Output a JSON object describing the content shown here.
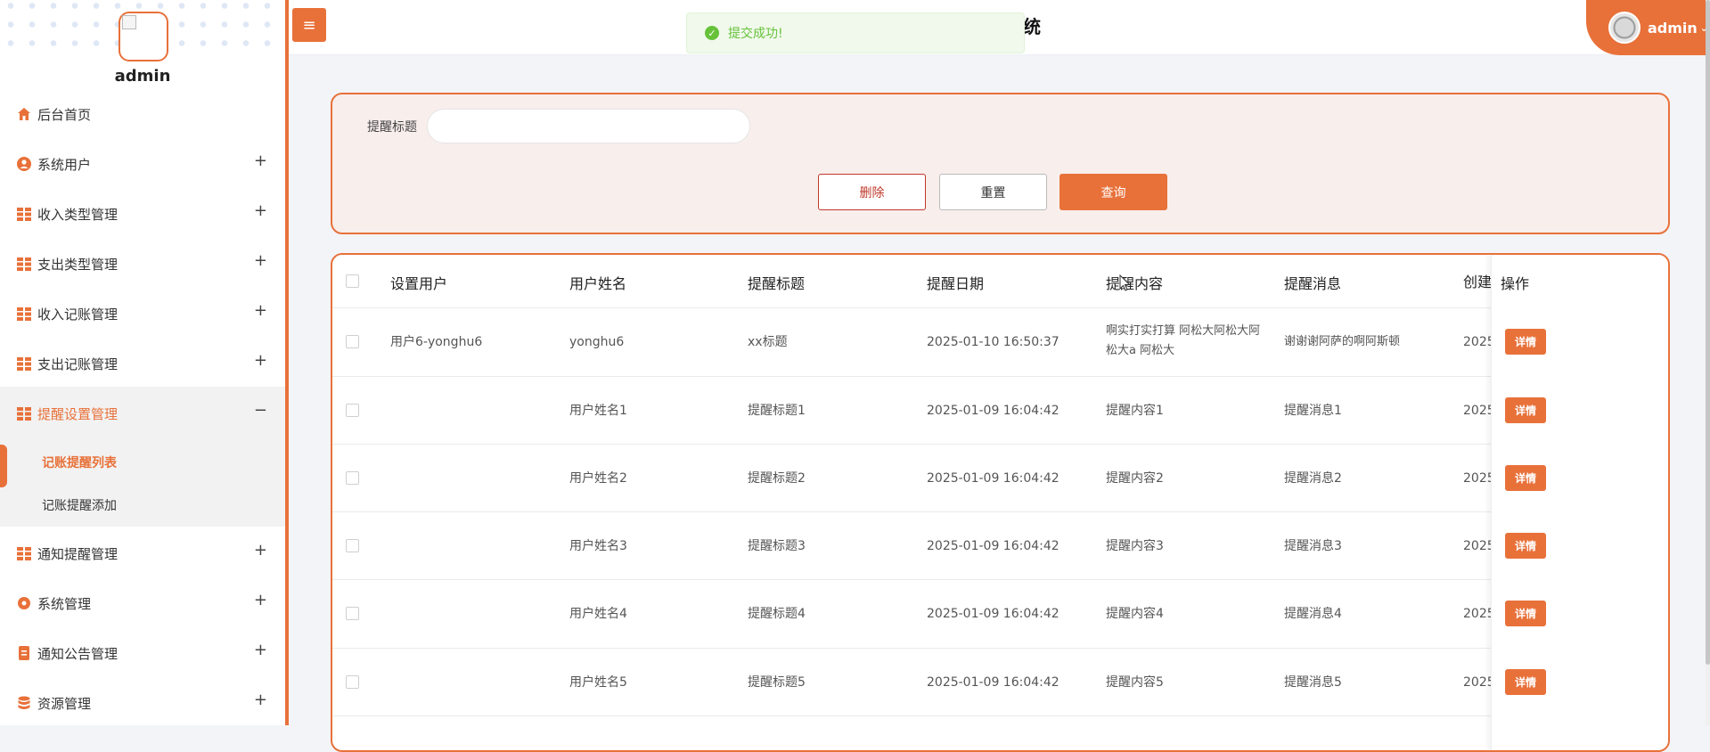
{
  "sidebar": {
    "username": "admin",
    "menu": [
      {
        "label": "后台首页",
        "icon": "home-icon",
        "expandable": false
      },
      {
        "label": "系统用户",
        "icon": "user-circle-icon",
        "expandable": true
      },
      {
        "label": "收入类型管理",
        "icon": "grid-icon",
        "expandable": true
      },
      {
        "label": "支出类型管理",
        "icon": "grid-icon",
        "expandable": true
      },
      {
        "label": "收入记账管理",
        "icon": "grid-icon",
        "expandable": true
      },
      {
        "label": "支出记账管理",
        "icon": "grid-icon",
        "expandable": true
      },
      {
        "label": "提醒设置管理",
        "icon": "grid-icon",
        "expandable": true,
        "expanded": true
      },
      {
        "label": "通知提醒管理",
        "icon": "grid-icon",
        "expandable": true
      },
      {
        "label": "系统管理",
        "icon": "gear-icon",
        "expandable": true
      },
      {
        "label": "通知公告管理",
        "icon": "document-icon",
        "expandable": true
      },
      {
        "label": "资源管理",
        "icon": "database-icon",
        "expandable": true
      }
    ],
    "submenu": [
      {
        "label": "记账提醒列表",
        "current": true
      },
      {
        "label": "记账提醒添加",
        "current": false
      }
    ],
    "plus": "+",
    "minus": "−"
  },
  "header": {
    "title_fragment": "统",
    "toast": "提交成功!",
    "user": "admin",
    "toggle_icon": "≡"
  },
  "search": {
    "label": "提醒标题",
    "value": "",
    "delete_label": "删除",
    "reset_label": "重置",
    "query_label": "查询"
  },
  "table": {
    "columns": [
      "设置用户",
      "用户姓名",
      "提醒标题",
      "提醒日期",
      "提醒内容",
      "提醒消息",
      "创建",
      "操作"
    ],
    "detail_label": "详情",
    "rows": [
      {
        "set_user": "用户6-yonghu6",
        "name": "yonghu6",
        "title": "xx标题",
        "date": "2025-01-10 16:50:37",
        "content": "啊实打实打算 阿松大阿松大阿松大a 阿松大",
        "message": "谢谢谢阿萨的啊阿斯顿",
        "created": "2025"
      },
      {
        "set_user": "",
        "name": "用户姓名1",
        "title": "提醒标题1",
        "date": "2025-01-09 16:04:42",
        "content": "提醒内容1",
        "message": "提醒消息1",
        "created": "2025"
      },
      {
        "set_user": "",
        "name": "用户姓名2",
        "title": "提醒标题2",
        "date": "2025-01-09 16:04:42",
        "content": "提醒内容2",
        "message": "提醒消息2",
        "created": "2025"
      },
      {
        "set_user": "",
        "name": "用户姓名3",
        "title": "提醒标题3",
        "date": "2025-01-09 16:04:42",
        "content": "提醒内容3",
        "message": "提醒消息3",
        "created": "2025"
      },
      {
        "set_user": "",
        "name": "用户姓名4",
        "title": "提醒标题4",
        "date": "2025-01-09 16:04:42",
        "content": "提醒内容4",
        "message": "提醒消息4",
        "created": "2025"
      },
      {
        "set_user": "",
        "name": "用户姓名5",
        "title": "提醒标题5",
        "date": "2025-01-09 16:04:42",
        "content": "提醒内容5",
        "message": "提醒消息5",
        "created": "2025"
      }
    ]
  },
  "colors": {
    "accent": "#e8713a",
    "success": "#67c23a",
    "danger": "#c0392b"
  }
}
